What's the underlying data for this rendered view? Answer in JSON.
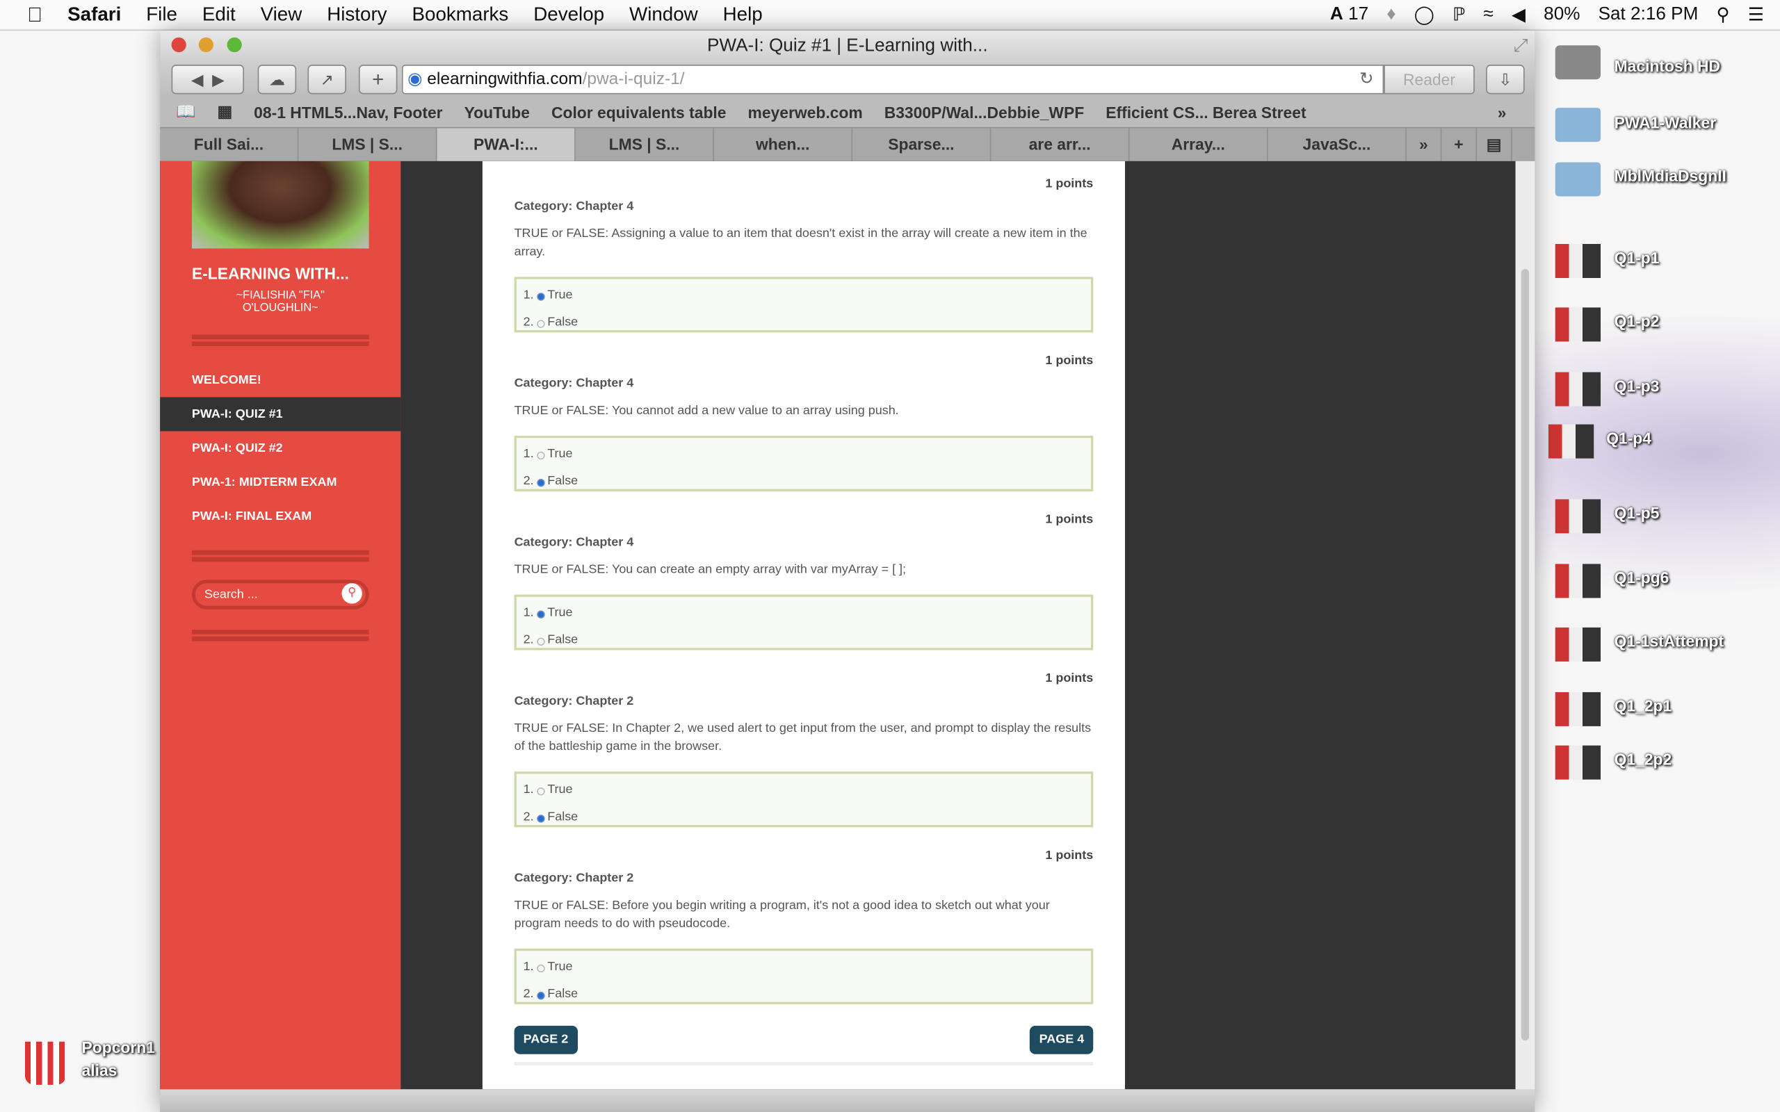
{
  "menubar": {
    "app": "Safari",
    "items": [
      "File",
      "Edit",
      "View",
      "History",
      "Bookmarks",
      "Develop",
      "Window",
      "Help"
    ],
    "adobe_count": "17",
    "battery": "80%",
    "clock": "Sat 2:16 PM"
  },
  "window": {
    "title": "PWA-I: Quiz #1 | E-Learning with...",
    "url_domain": "elearningwithfia.com",
    "url_path": "/pwa-i-quiz-1/",
    "reader": "Reader"
  },
  "bookmarks": [
    "08-1 HTML5...Nav, Footer",
    "YouTube",
    "Color equivalents table",
    "meyerweb.com",
    "B3300P/Wal...Debbie_WPF",
    "Efficient CS... Berea Street"
  ],
  "tabs": [
    "Full Sai...",
    "LMS | S...",
    "PWA-I:...",
    "LMS | S...",
    "when...",
    "Sparse...",
    "are arr...",
    "Array...",
    "JavaSc..."
  ],
  "sidebar": {
    "site_title": "E-LEARNING WITH...",
    "subtitle_1": "~FIALISHIA \"FIA\"",
    "subtitle_2": "O'LOUGHLIN~",
    "nav": [
      "WELCOME!",
      "PWA-I: QUIZ #1",
      "PWA-I: QUIZ #2",
      "PWA-1: MIDTERM EXAM",
      "PWA-I: FINAL EXAM"
    ],
    "search_placeholder": "Search ..."
  },
  "quiz": {
    "questions": [
      {
        "points": "1 points",
        "category": "Category: Chapter 4",
        "text": "TRUE or FALSE:  Assigning a value to an item that doesn't exist in the array will create a new item in the array.",
        "answers": [
          "True",
          "False"
        ],
        "selected": 0
      },
      {
        "points": "1 points",
        "category": "Category: Chapter 4",
        "text": "TRUE or FALSE:  You cannot add a new value to an array using push.",
        "answers": [
          "True",
          "False"
        ],
        "selected": 1
      },
      {
        "points": "1 points",
        "category": "Category: Chapter 4",
        "text": "TRUE or FALSE:  You can create an empty array with var myArray = [ ];",
        "answers": [
          "True",
          "False"
        ],
        "selected": 0
      },
      {
        "points": "1 points",
        "category": "Category: Chapter 2",
        "text": "TRUE or FALSE:  In Chapter 2, we used alert to get input from the user, and prompt to display the results of the battleship game in the browser.",
        "answers": [
          "True",
          "False"
        ],
        "selected": 1
      },
      {
        "points": "1 points",
        "category": "Category: Chapter 2",
        "text": "TRUE or FALSE:  Before you begin writing a program, it's not a good idea to sketch out what your program needs to do with pseudocode.",
        "answers": [
          "True",
          "False"
        ],
        "selected": 1
      }
    ],
    "prev": "PAGE 2",
    "next": "PAGE 4"
  },
  "desktop": [
    "Macintosh HD",
    "PWA1-Walker",
    "MblMdiaDsgnII",
    "Q1-p1",
    "Q1-p2",
    "Q1-p3",
    "Q1-p4",
    "Q1-p5",
    "Q1-pg6",
    "Q1-1stAttempt",
    "Q1_2p1",
    "Q1_2p2"
  ],
  "popcorn": {
    "line1": "Popcorn1",
    "line2": "alias"
  }
}
